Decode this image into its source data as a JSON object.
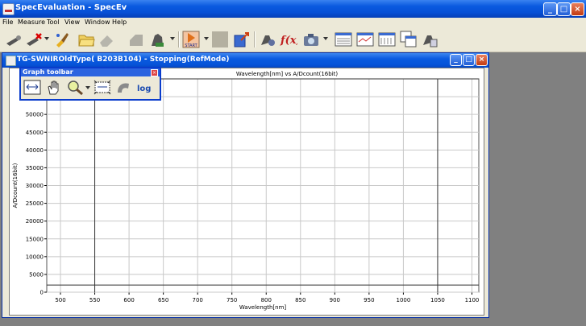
{
  "app": {
    "title": "SpecEvaluation - SpecEv",
    "window_controls": {
      "minimize": "_",
      "maximize": "□",
      "close": "×"
    }
  },
  "menu": {
    "items": [
      {
        "id": "file",
        "label": "File"
      },
      {
        "id": "measure",
        "label": "Measure"
      },
      {
        "id": "tool",
        "label": "Tool"
      },
      {
        "id": "view",
        "label": "View"
      },
      {
        "id": "window",
        "label": "Window"
      },
      {
        "id": "help",
        "label": "Help"
      }
    ]
  },
  "toolbar": {
    "start_label": "START",
    "buttons": [
      "probe-icon",
      "probe-red-icon",
      "brush-icon",
      "open-folder-icon",
      "eraser-icon",
      "grey-block-icon",
      "hand-slash-icon",
      "start-icon",
      "stop-block-icon",
      "export-icon",
      "settings-icon",
      "function-icon",
      "camera-icon",
      "view-1-icon",
      "view-2-icon",
      "view-3-icon",
      "view-4-icon",
      "save-icon"
    ]
  },
  "child_window": {
    "title": "TG-SWNIROldType( B203B104) - Stopping(RefMode)"
  },
  "graph_toolbar": {
    "title": "Graph toolbar",
    "close": "×",
    "buttons": [
      "fit-icon",
      "pan-hand-icon",
      "zoom-icon",
      "zoom-box-icon",
      "undo-icon",
      "log-icon"
    ],
    "log_label": "log"
  },
  "chart_data": {
    "type": "line",
    "title": "Wavelength[nm] vs A/Dcount(16bit)",
    "xlabel": "Wavelength[nm]",
    "ylabel": "A/Dcount(16bit)",
    "xlim": [
      480,
      1110
    ],
    "ylim": [
      0,
      60000
    ],
    "xticks": [
      "500",
      "550",
      "600",
      "650",
      "700",
      "750",
      "800",
      "850",
      "900",
      "950",
      "1000",
      "1050",
      "1100"
    ],
    "yticks": [
      "0",
      "5000",
      "10000",
      "15000",
      "20000",
      "25000",
      "30000",
      "35000",
      "40000",
      "45000",
      "50000",
      "55000",
      "60000"
    ],
    "grid": true,
    "markers": {
      "x_cursors": [
        550,
        1050
      ],
      "y_cursors": [
        2000,
        60000
      ]
    },
    "series": []
  }
}
